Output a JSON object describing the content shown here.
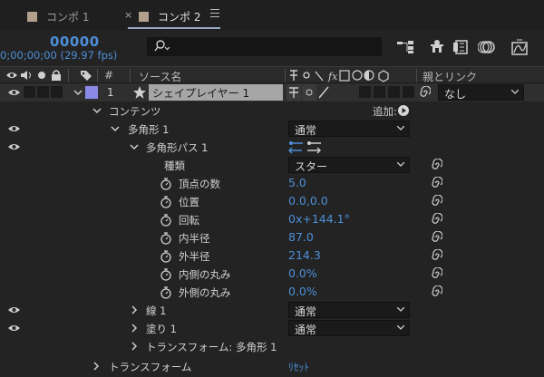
{
  "tabs": [
    {
      "label": "コンポ 1",
      "color": "#b0a08c"
    },
    {
      "label": "コンポ 2",
      "color": "#b0a08c"
    }
  ],
  "close_glyph": "×",
  "timecode": "00000",
  "timecode_sub": "0;00;00;00 (29.97 fps)",
  "search": {
    "placeholder": ""
  },
  "columns": {
    "num": "#",
    "source": "ソース名",
    "parent": "親とリンク"
  },
  "layer": {
    "number": "1",
    "name": "シェイプレイヤー 1",
    "label_color": "#8a8ae6",
    "parent_value": "なし"
  },
  "rows": {
    "contents": "コンテンツ",
    "add_label": "追加:",
    "polygon": "多角形 1",
    "polygon_mode": "通常",
    "polygon_path": "多角形パス 1",
    "type_label": "種類",
    "type_value": "スター",
    "points_label": "頂点の数",
    "points_value": "5.0",
    "position_label": "位置",
    "position_value": "0.0,0.0",
    "rotation_label": "回転",
    "rotation_value": "0x+144.1°",
    "inner_radius_label": "内半径",
    "inner_radius_value": "87.0",
    "outer_radius_label": "外半径",
    "outer_radius_value": "214.3",
    "inner_roundness_label": "内側の丸み",
    "inner_roundness_value": "0.0%",
    "outer_roundness_label": "外側の丸み",
    "outer_roundness_value": "0.0%",
    "stroke": "線 1",
    "stroke_mode": "通常",
    "fill": "塗り 1",
    "fill_mode": "通常",
    "polygon_transform": "トランスフォーム: 多角形 1",
    "transform": "トランスフォーム",
    "reset": "ﾘｾｯﾄ"
  },
  "colors": {
    "accent": "#4d8fd8",
    "background": "#232323"
  }
}
